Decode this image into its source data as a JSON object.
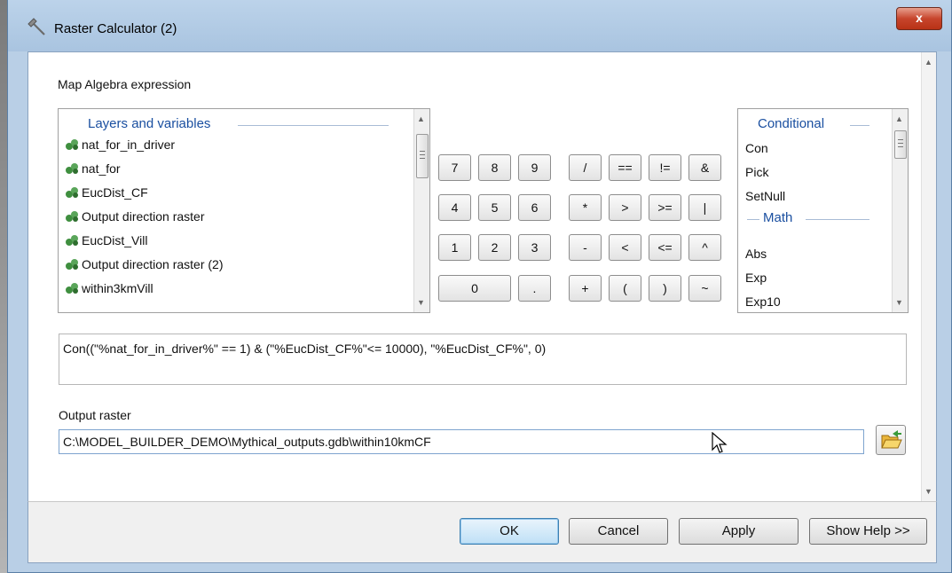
{
  "window": {
    "title": "Raster Calculator (2)",
    "close_label": "x"
  },
  "expression_label": "Map Algebra expression",
  "layers": {
    "header": "Layers and variables",
    "items": [
      "nat_for_in_driver",
      "nat_for",
      "EucDist_CF",
      "Output direction raster",
      "EucDist_Vill",
      "Output direction raster (2)",
      "within3kmVill"
    ]
  },
  "keypad": {
    "row1": [
      "7",
      "8",
      "9",
      "/",
      "==",
      "!=",
      "&"
    ],
    "row2": [
      "4",
      "5",
      "6",
      "*",
      ">",
      ">=",
      "|"
    ],
    "row3": [
      "1",
      "2",
      "3",
      "-",
      "<",
      "<=",
      "^"
    ],
    "row4": [
      "0",
      ".",
      "+",
      "(",
      ")",
      "~"
    ]
  },
  "functions": {
    "conditional_header": "Conditional",
    "conditional_items": [
      "Con",
      "Pick",
      "SetNull"
    ],
    "math_header": "Math",
    "math_items": [
      "Abs",
      "Exp",
      "Exp10"
    ]
  },
  "expression": "Con((\"%nat_for_in_driver%\" == 1) & (\"%EucDist_CF%\"<= 10000), \"%EucDist_CF%\", 0)",
  "output": {
    "label": "Output raster",
    "value": "C:\\MODEL_BUILDER_DEMO\\Mythical_outputs.gdb\\within10kmCF"
  },
  "buttons": {
    "ok": "OK",
    "cancel": "Cancel",
    "apply": "Apply",
    "help": "Show Help >>"
  },
  "colors": {
    "header_blue": "#1a4fa0",
    "close_red": "#c7452c"
  },
  "icons": {
    "layer": "raster-layer-icon",
    "folder": "open-folder-icon",
    "title": "hammer-icon"
  }
}
